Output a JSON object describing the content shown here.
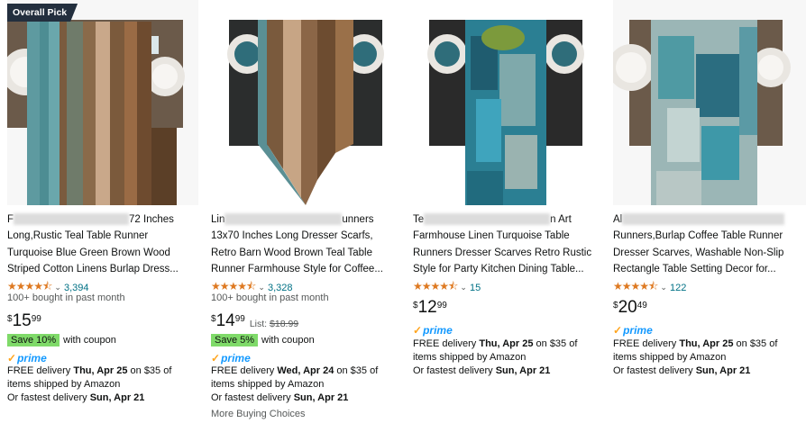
{
  "cards": [
    {
      "badge": "Overall Pick",
      "title_vis1": "F",
      "title_vis2": "72 Inches",
      "title_line2": "Long,Rustic Teal Table Runner",
      "title_line3": "Turquoise Blue Green Brown Wood",
      "title_line4": "Striped Cotton Linens Burlap Dress...",
      "rating_count": "3,394",
      "stars": "★★★★⯪",
      "bought": "100+ bought in past month",
      "price_symbol": "$",
      "price_whole": "15",
      "price_frac": "99",
      "save_label": "Save 10%",
      "coupon_text": "with coupon",
      "prime": "prime",
      "delivery_prefix": "FREE delivery ",
      "delivery_date": "Thu, Apr 25",
      "delivery_suffix": " on $35 of items shipped by Amazon",
      "fastest_prefix": "Or fastest delivery ",
      "fastest_date": "Sun, Apr 21"
    },
    {
      "title_vis1": "Lin",
      "title_vis2": "unners",
      "title_line2": "13x70 Inches Long Dresser Scarfs,",
      "title_line3": "Retro Barn Wood Brown Teal Table",
      "title_line4": "Runner Farmhouse Style for Coffee...",
      "rating_count": "3,328",
      "stars": "★★★★⯪",
      "bought": "100+ bought in past month",
      "price_symbol": "$",
      "price_whole": "14",
      "price_frac": "99",
      "list_label": "List:",
      "list_price": "$18.99",
      "save_label": "Save 5%",
      "coupon_text": "with coupon",
      "prime": "prime",
      "delivery_prefix": "FREE delivery ",
      "delivery_date": "Wed, Apr 24",
      "delivery_suffix": " on $35 of items shipped by Amazon",
      "fastest_prefix": "Or fastest delivery ",
      "fastest_date": "Sun, Apr 21",
      "more": "More Buying Choices"
    },
    {
      "title_vis1": "Te",
      "title_vis2": "n Art",
      "title_line2": "Farmhouse Linen Turquoise Table",
      "title_line3": "Runners Dresser Scarves Retro Rustic",
      "title_line4": "Style for Party Kitchen Dining Table...",
      "rating_count": "15",
      "stars": "★★★★⯪",
      "price_symbol": "$",
      "price_whole": "12",
      "price_frac": "99",
      "prime": "prime",
      "delivery_prefix": "FREE delivery ",
      "delivery_date": "Thu, Apr 25",
      "delivery_suffix": " on $35 of items shipped by Amazon",
      "fastest_prefix": "Or fastest delivery ",
      "fastest_date": "Sun, Apr 21"
    },
    {
      "title_vis1": "Al",
      "title_vis2": "",
      "title_line2": "Runners,Burlap Coffee Table Runner",
      "title_line3": "Dresser Scarves, Washable Non-Slip",
      "title_line4": "Rectangle Table Setting Decor for...",
      "rating_count": "122",
      "stars": "★★★★⯪",
      "price_symbol": "$",
      "price_whole": "20",
      "price_frac": "49",
      "prime": "prime",
      "delivery_prefix": "FREE delivery ",
      "delivery_date": "Thu, Apr 25",
      "delivery_suffix": " on $35 of items shipped by Amazon",
      "fastest_prefix": "Or fastest delivery ",
      "fastest_date": "Sun, Apr 21"
    }
  ]
}
